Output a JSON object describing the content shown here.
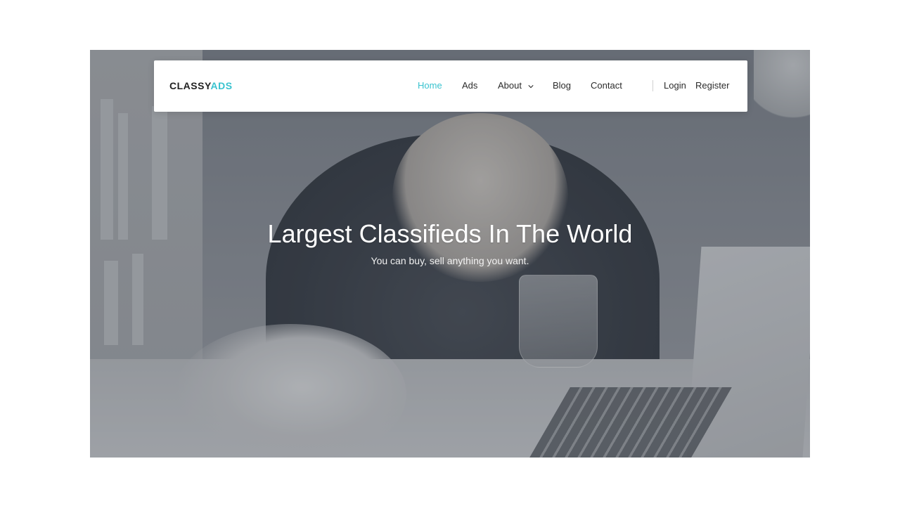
{
  "brand": {
    "part1": "CLASSY",
    "part2": "ADS",
    "accent_color": "#39c3cf"
  },
  "nav": {
    "items": [
      {
        "label": "Home",
        "active": true
      },
      {
        "label": "Ads"
      },
      {
        "label": "About",
        "has_dropdown": true
      },
      {
        "label": "Blog"
      },
      {
        "label": "Contact"
      }
    ],
    "login": "Login",
    "register": "Register"
  },
  "hero": {
    "title": "Largest Classifieds In The World",
    "subtitle": "You can buy, sell anything you want."
  }
}
